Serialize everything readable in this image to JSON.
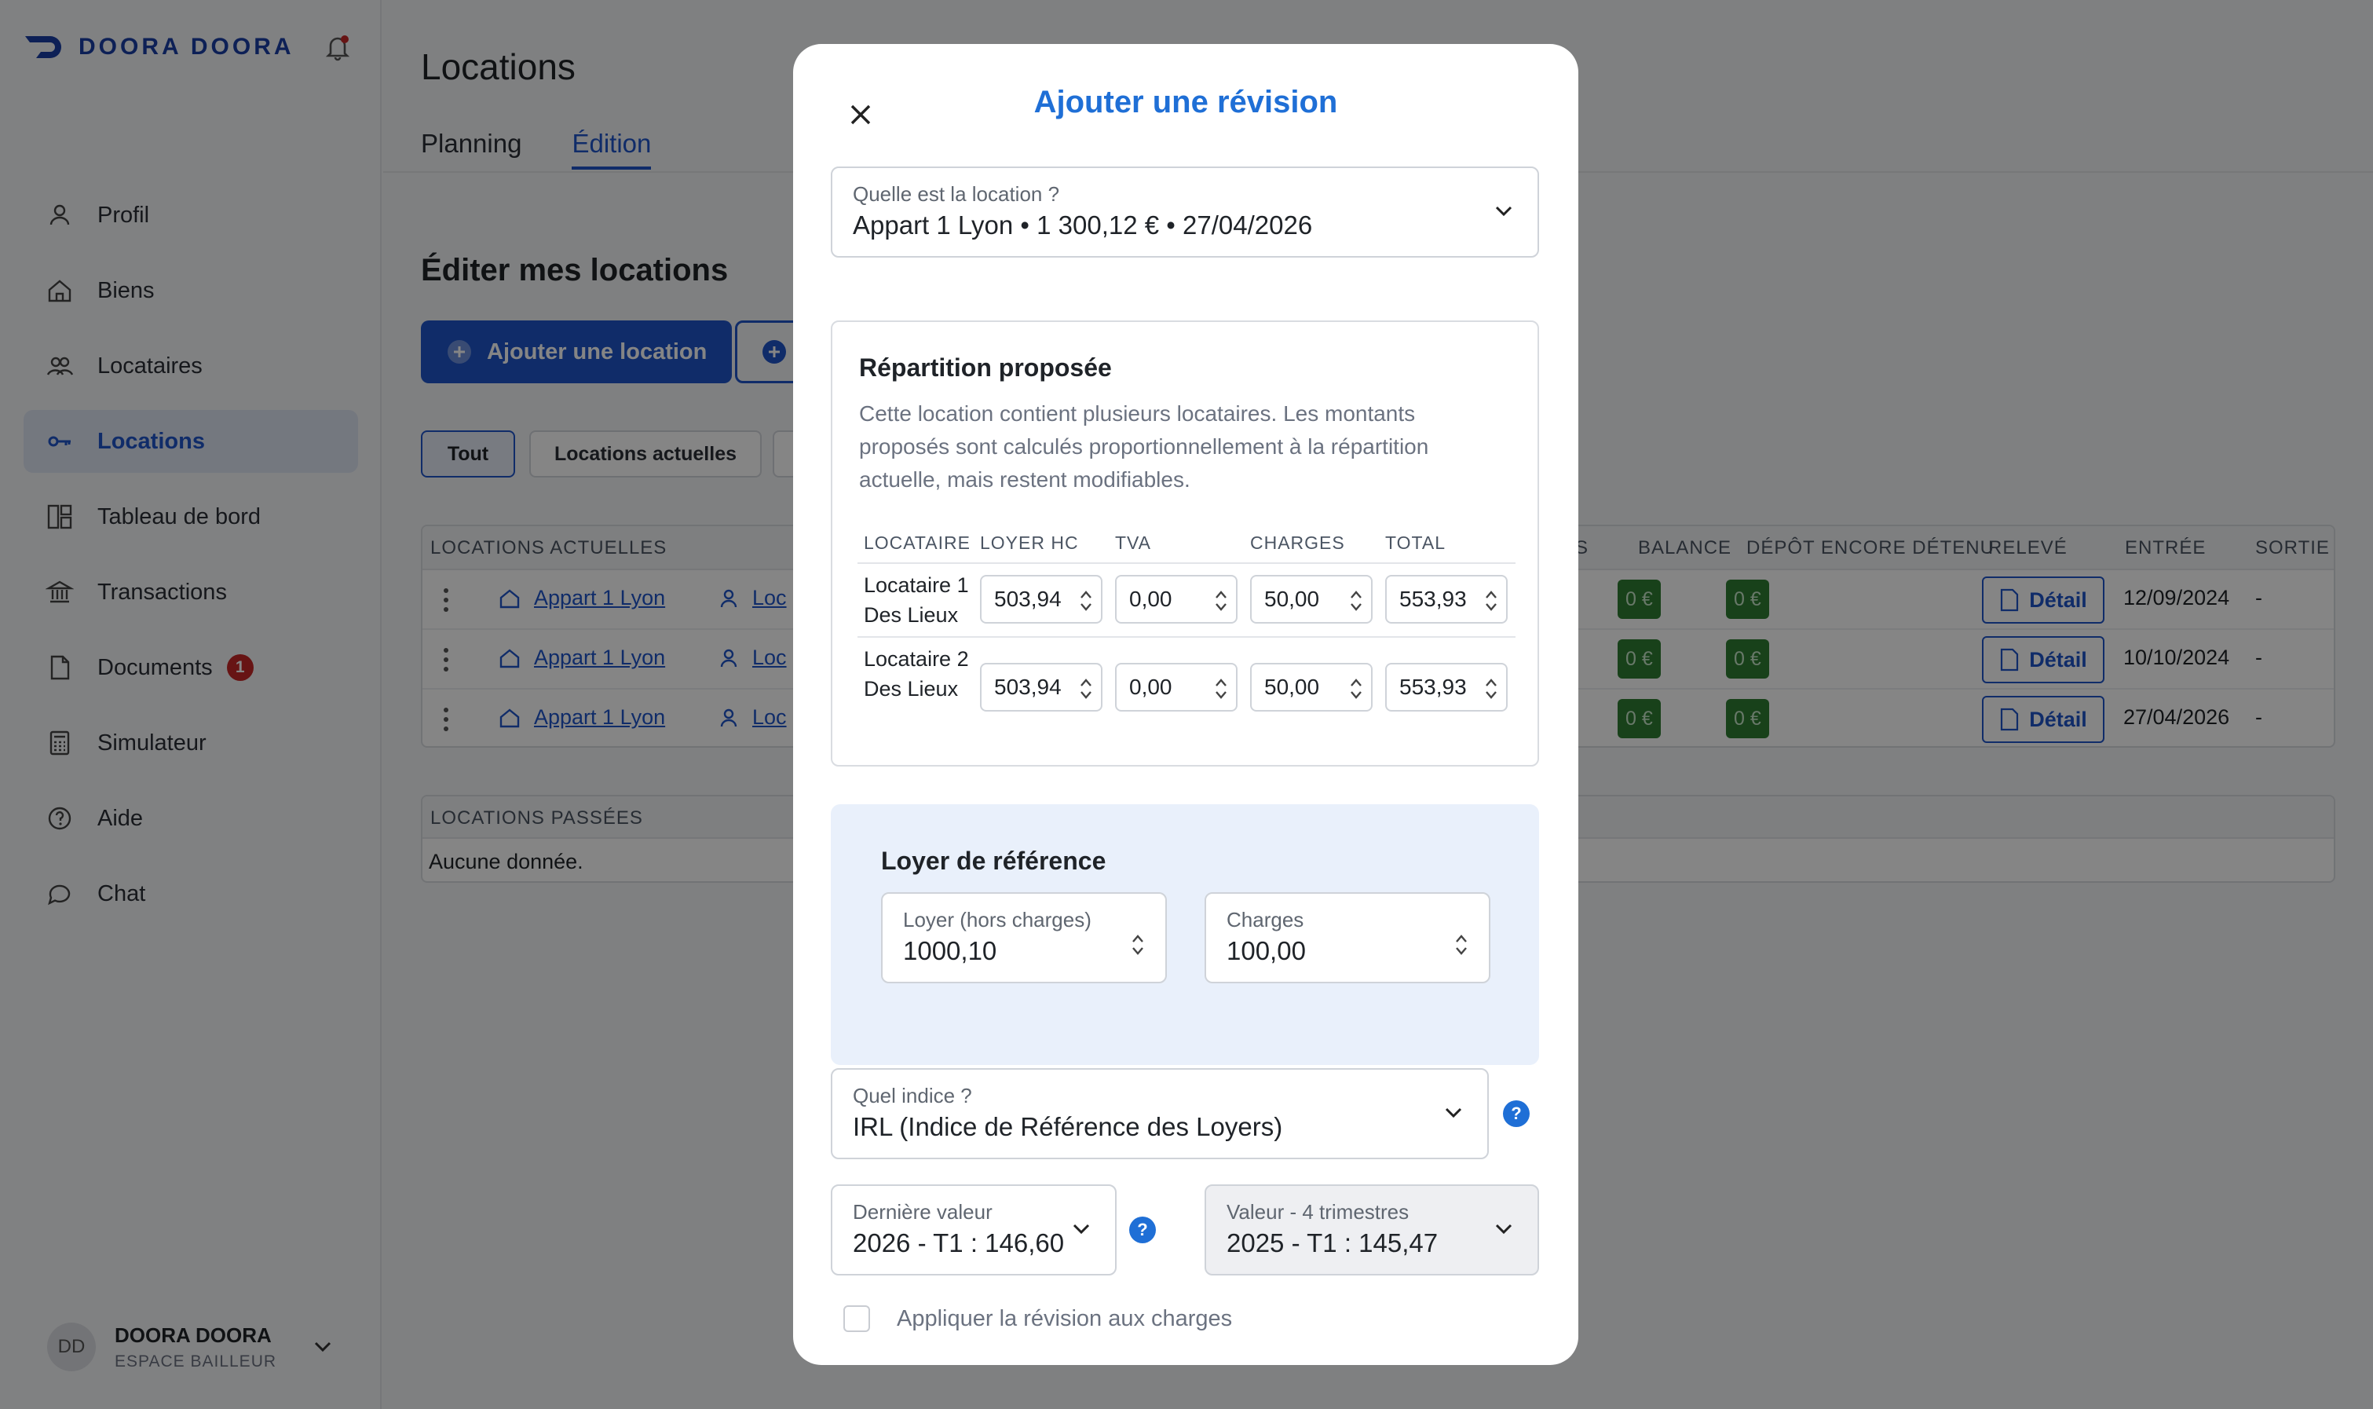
{
  "brand": {
    "name": "DOORA DOORA"
  },
  "sidebar": {
    "items": [
      {
        "label": "Profil",
        "icon": "user-icon"
      },
      {
        "label": "Biens",
        "icon": "home-icon"
      },
      {
        "label": "Locataires",
        "icon": "users-icon"
      },
      {
        "label": "Locations",
        "icon": "key-icon",
        "active": true
      },
      {
        "label": "Tableau de bord",
        "icon": "dashboard-icon"
      },
      {
        "label": "Transactions",
        "icon": "bank-icon"
      },
      {
        "label": "Documents",
        "icon": "document-icon",
        "badge": "1"
      },
      {
        "label": "Simulateur",
        "icon": "calculator-icon"
      },
      {
        "label": "Aide",
        "icon": "help-circle-icon"
      },
      {
        "label": "Chat",
        "icon": "chat-icon"
      }
    ]
  },
  "user": {
    "initials": "DD",
    "name": "DOORA DOORA",
    "role": "ESPACE BAILLEUR"
  },
  "page": {
    "title": "Locations",
    "tabs": [
      "Planning",
      "Édition"
    ],
    "section_title": "Éditer mes locations",
    "add_button": "Ajouter une location",
    "filters": [
      "Tout",
      "Locations actuelles"
    ]
  },
  "current_table": {
    "title": "LOCATIONS ACTUELLES",
    "headers": {
      "s": "S",
      "balance": "BALANCE",
      "deposit": "DÉPÔT ENCORE DÉTENU",
      "releve": "RELEVÉ",
      "entree": "ENTRÉE",
      "sortie": "SORTIE"
    },
    "rows": [
      {
        "property": "Appart 1 Lyon",
        "tenant": "Loc",
        "balance": "0 €",
        "deposit": "0 €",
        "detail": "Détail",
        "entree": "12/09/2024",
        "sortie": "-"
      },
      {
        "property": "Appart 1 Lyon",
        "tenant": "Loc",
        "balance": "0 €",
        "deposit": "0 €",
        "detail": "Détail",
        "entree": "10/10/2024",
        "sortie": "-"
      },
      {
        "property": "Appart 1 Lyon",
        "tenant": "Loc",
        "balance": "0 €",
        "deposit": "0 €",
        "detail": "Détail",
        "entree": "27/04/2026",
        "sortie": "-"
      }
    ]
  },
  "past_table": {
    "title": "LOCATIONS PASSÉES",
    "empty": "Aucune donnée."
  },
  "modal": {
    "title": "Ajouter une révision",
    "location_label": "Quelle est la location ?",
    "location_value": "Appart 1 Lyon • 1 300,12 € • 27/04/2026",
    "repartition": {
      "title": "Répartition proposée",
      "description": "Cette location contient plusieurs locataires. Les montants proposés sont calculés proportionnellement à la répartition actuelle, mais restent modifiables.",
      "headers": [
        "LOCATAIRE",
        "LOYER HC",
        "TVA",
        "CHARGES",
        "TOTAL"
      ],
      "rows": [
        {
          "tenant": "Locataire 1 Des Lieux",
          "loyer": "503,94",
          "tva": "0,00",
          "charges": "50,00",
          "total": "553,93"
        },
        {
          "tenant": "Locataire 2 Des Lieux",
          "loyer": "503,94",
          "tva": "0,00",
          "charges": "50,00",
          "total": "553,93"
        }
      ]
    },
    "reference": {
      "title": "Loyer de référence",
      "loyer_label": "Loyer (hors charges)",
      "loyer_value": "1000,10",
      "charges_label": "Charges",
      "charges_value": "100,00"
    },
    "indice_label": "Quel indice ?",
    "indice_value": "IRL (Indice de Référence des Loyers)",
    "derniere_label": "Dernière valeur",
    "derniere_value": "2026 - T1 : 146,60",
    "valeur4_label": "Valeur - 4 trimestres",
    "valeur4_value": "2025 - T1 : 145,47",
    "help_glyph": "?",
    "apply_charges_label": "Appliquer la révision aux charges"
  },
  "colors": {
    "accent": "#1f55c9",
    "title_blue": "#1f6fd6",
    "badge_green": "#2e7d32",
    "badge_red": "#c62828"
  }
}
